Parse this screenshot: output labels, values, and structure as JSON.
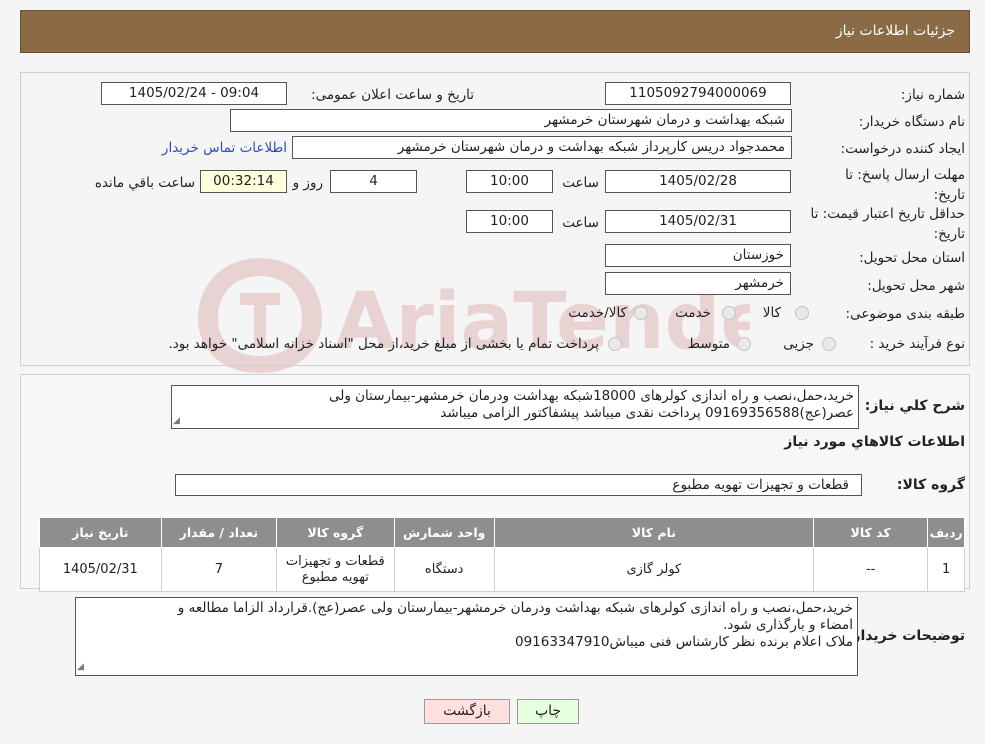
{
  "header": {
    "title": "جزئیات اطلاعات نیاز"
  },
  "fields": {
    "need_number_label": "شماره نیاز:",
    "need_number": "1105092794000069",
    "announce_label": "تاریخ و ساعت اعلان عمومی:",
    "announce_value": "1405/02/24 - 09:04",
    "buyer_org_label": "نام دستگاه خریدار:",
    "buyer_org": "شبکه بهداشت و درمان شهرستان خرمشهر",
    "creator_label": "ایجاد کننده درخواست:",
    "creator": "محمدجواد دریس کارپرداز شبکه بهداشت و درمان شهرستان خرمشهر",
    "contact_link": "اطلاعات تماس خریدار",
    "deadline_label_1": "مهلت ارسال پاسخ: تا",
    "deadline_label_2": "تاریخ:",
    "deadline_date": "1405/02/28",
    "time_label": "ساعت",
    "deadline_time": "10:00",
    "days_value": "4",
    "days_label": "روز و",
    "remaining_time": "00:32:14",
    "remaining_label": "ساعت باقي مانده",
    "validity_label_1": "حداقل تاریخ اعتبار قیمت: تا",
    "validity_label_2": "تاریخ:",
    "validity_date": "1405/02/31",
    "validity_time": "10:00",
    "province_label": "استان محل تحویل:",
    "province": "خوزستان",
    "city_label": "شهر محل تحویل:",
    "city": "خرمشهر",
    "category_label": "طبقه بندی موضوعی:",
    "category_options": [
      "کالا",
      "خدمت",
      "کالا/خدمت"
    ],
    "process_label": "نوع فرآیند خرید :",
    "process_options": [
      "جزیی",
      "متوسط"
    ],
    "process_note": "پرداخت تمام یا بخشی از مبلغ خرید،از محل \"اسناد خزانه اسلامی\" خواهد بود."
  },
  "description": {
    "label": "شرح کلي نياز:",
    "text": "خرید،حمل،نصب و راه اندازی کولرهای 18000شبکه بهداشت ودرمان خرمشهر-بیمارستان ولی عصر(عج)09169356588 پرداخت نقدی میباشد پیشفاکتور الزامی میباشد"
  },
  "goods_info_title": "اطلاعات كالاهاي مورد نياز",
  "goods_group": {
    "label": "گروه کالا:",
    "value": "قطعات و تجهیزات تهویه مطبوع"
  },
  "table": {
    "headers": [
      "ردیف",
      "کد کالا",
      "نام کالا",
      "واحد شمارش",
      "گروه کالا",
      "تعداد / مقدار",
      "تاریخ نیاز"
    ],
    "rows": [
      [
        "1",
        "--",
        "کولر گازی",
        "دستگاه",
        "قطعات و تجهیزات تهویه مطبوع",
        "7",
        "1405/02/31"
      ]
    ]
  },
  "buyer_notes": {
    "label": "توضیحات خریدار:",
    "lines": [
      "خرید،حمل،نصب و راه اندازی کولرهای شبکه بهداشت ودرمان خرمشهر-بیمارستان ولی عصر(عج).قرارداد الزاما مطالعه و",
      "امضاء و بارگذاری شود.",
      "ملاک اعلام برنده نظر کارشناس فنی میباش09163347910"
    ]
  },
  "buttons": {
    "print": "چاپ",
    "back": "بازگشت"
  },
  "colors": {
    "header_bg": "#8b6b45",
    "table_header_bg": "#8e8e8e",
    "back_button_bg": "#ffe0e0",
    "print_button_bg": "#e6ffdf",
    "link": "#2a4fb8"
  }
}
